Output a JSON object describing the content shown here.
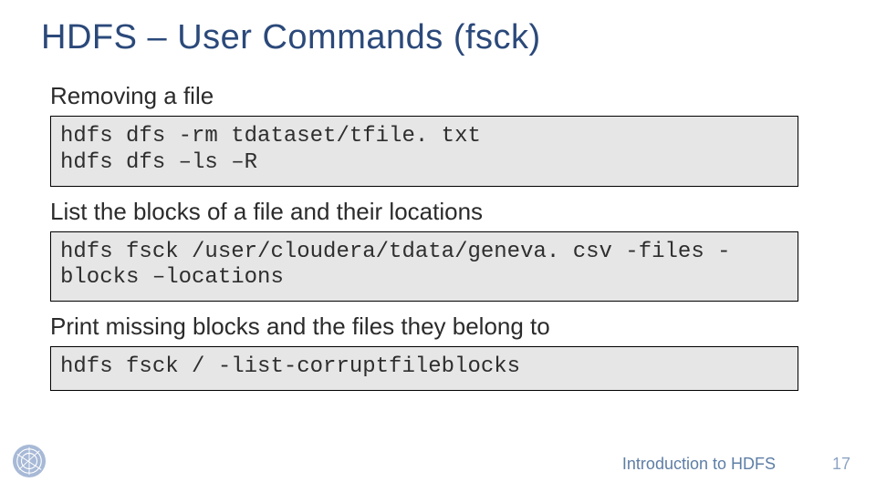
{
  "title": "HDFS – User Commands (fsck)",
  "sections": [
    {
      "label": "Removing a file",
      "code": "hdfs dfs -rm tdataset/tfile. txt\nhdfs dfs –ls –R"
    },
    {
      "label": "List the blocks of a file and their locations",
      "code": "hdfs fsck /user/cloudera/tdata/geneva. csv -files -blocks –locations"
    },
    {
      "label": "Print missing blocks and the files they belong to",
      "code": "hdfs fsck / -list-corruptfileblocks"
    }
  ],
  "footer": {
    "text": "Introduction to HDFS",
    "page": "17"
  }
}
